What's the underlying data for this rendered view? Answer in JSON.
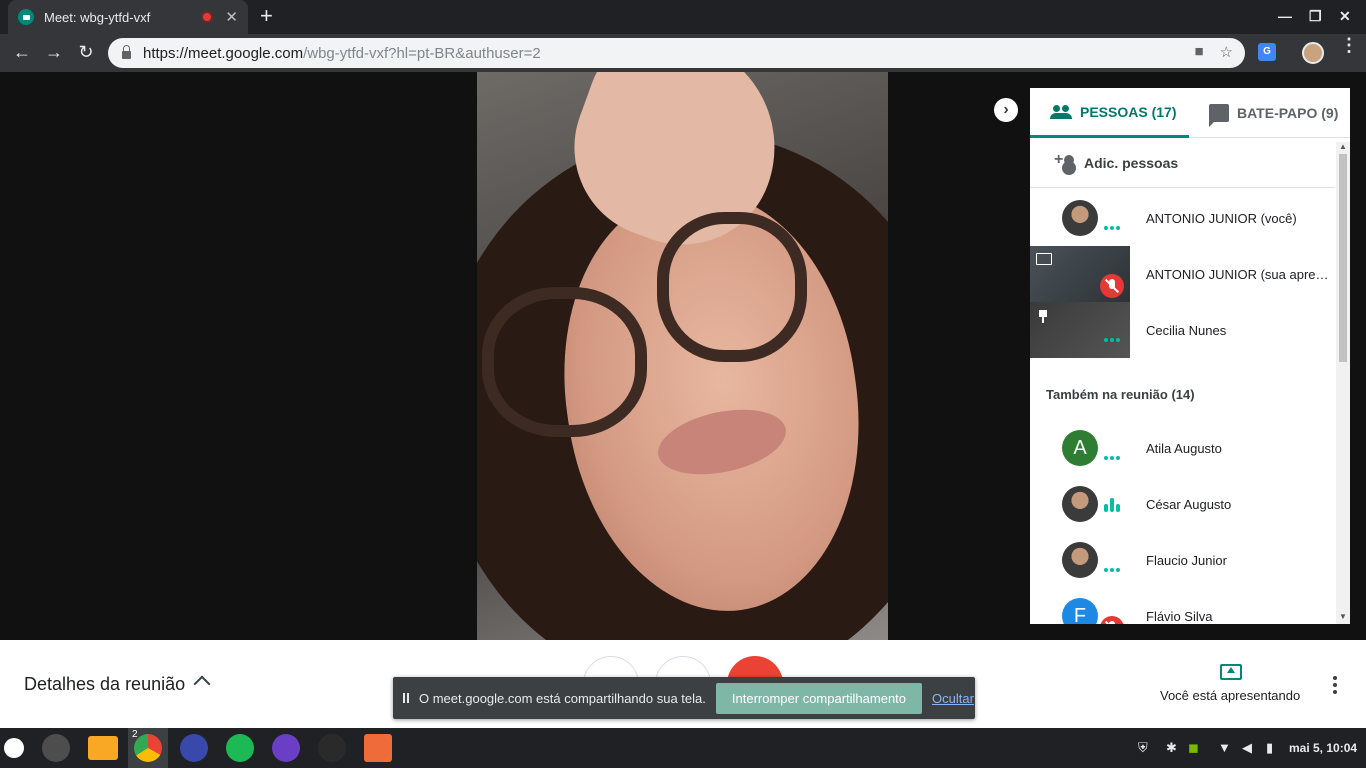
{
  "browser": {
    "tab_title": "Meet: wbg-ytfd-vxf",
    "url_host": "https://meet.google.com",
    "url_path": "/wbg-ytfd-vxf?hl=pt-BR&authuser=2"
  },
  "panel": {
    "tab_people": "PESSOAS (17)",
    "tab_chat": "BATE-PAPO (9)",
    "add_people": "Adic. pessoas",
    "pinned": [
      {
        "name": "ANTONIO JUNIOR (você)",
        "status": "dots"
      },
      {
        "name": "ANTONIO JUNIOR (sua apresentação)",
        "status": "muted"
      },
      {
        "name": "Cecilia Nunes",
        "status": "dots"
      }
    ],
    "also_heading": "Também na reunião (14)",
    "others": [
      {
        "name": "Atila Augusto",
        "initial": "A",
        "color": "#2e7d32",
        "status": "dots"
      },
      {
        "name": "César Augusto",
        "initial": "",
        "color": "",
        "status": "speaking"
      },
      {
        "name": "Flaucio Junior",
        "initial": "",
        "color": "",
        "status": "dots"
      },
      {
        "name": "Flávio Silva",
        "initial": "F",
        "color": "#1e88e5",
        "status": "muted"
      }
    ]
  },
  "bottom": {
    "details": "Detalhes da reunião",
    "presenting": "Você está apresentando"
  },
  "share_notice": {
    "message": "O meet.google.com está compartilhando sua tela.",
    "stop": "Interromper compartilhamento",
    "hide": "Ocultar"
  },
  "taskbar": {
    "chrome_badge": "2",
    "clock": "mai  5, 10:04"
  },
  "colors": {
    "accent": "#00897b",
    "mute_red": "#e53935",
    "hangup_red": "#ea4335"
  }
}
